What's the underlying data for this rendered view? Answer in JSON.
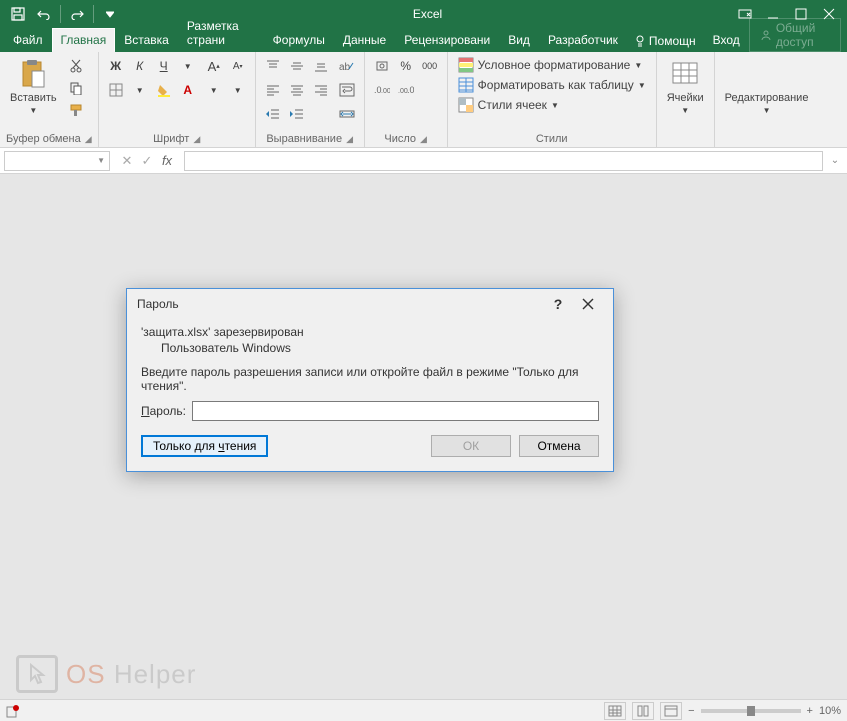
{
  "app": {
    "title": "Excel"
  },
  "tabs": {
    "file": "Файл",
    "items": [
      "Главная",
      "Вставка",
      "Разметка страни",
      "Формулы",
      "Данные",
      "Рецензировани",
      "Вид",
      "Разработчик"
    ],
    "active_index": 0,
    "tell_me": "Помощн",
    "sign_in": "Вход",
    "share": "Общий доступ"
  },
  "ribbon": {
    "clipboard": {
      "label": "Буфер обмена",
      "paste": "Вставить"
    },
    "font": {
      "label": "Шрифт",
      "bold": "Ж",
      "italic": "К",
      "underline": "Ч"
    },
    "alignment": {
      "label": "Выравнивание"
    },
    "number": {
      "label": "Число",
      "percent": "%",
      "thousands": "000"
    },
    "styles": {
      "label": "Стили",
      "conditional": "Условное форматирование",
      "format_table": "Форматировать как таблицу",
      "cell_styles": "Стили ячеек"
    },
    "cells": {
      "label": "Ячейки"
    },
    "editing": {
      "label": "Редактирование"
    }
  },
  "formula_bar": {
    "fx": "fx"
  },
  "dialog": {
    "title": "Пароль",
    "reserved_line": "'защита.xlsx' зарезервирован",
    "user_line": "Пользователь Windows",
    "instruction": "Введите пароль разрешения записи или откройте файл в режиме \"Только для чтения\".",
    "password_label": "Пароль:",
    "password_value": "",
    "read_only": "Только для чтения",
    "ok": "ОК",
    "cancel": "Отмена"
  },
  "statusbar": {
    "zoom": "10%"
  },
  "watermark": {
    "os": "OS",
    "helper": "Helper"
  }
}
